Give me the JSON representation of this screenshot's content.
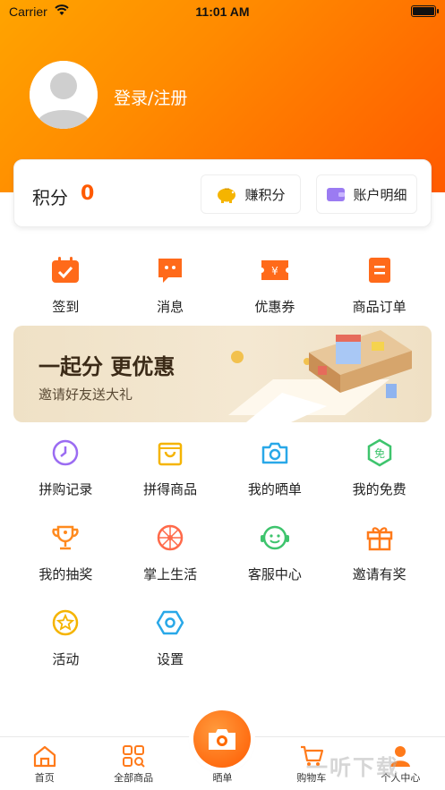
{
  "status_bar": {
    "carrier": "Carrier",
    "time": "11:01 AM"
  },
  "profile": {
    "login_label": "登录/注册"
  },
  "points": {
    "label": "积分",
    "value": "0",
    "earn_label": "赚积分",
    "detail_label": "账户明细"
  },
  "quick_actions": [
    {
      "label": "签到",
      "icon": "checkin-icon"
    },
    {
      "label": "消息",
      "icon": "message-icon"
    },
    {
      "label": "优惠券",
      "icon": "coupon-icon"
    },
    {
      "label": "商品订单",
      "icon": "order-icon"
    }
  ],
  "banner": {
    "title": "一起分 更优惠",
    "subtitle": "邀请好友送大礼"
  },
  "services": [
    {
      "label": "拼购记录",
      "icon": "clock-icon",
      "color": "#9b6cf2"
    },
    {
      "label": "拼得商品",
      "icon": "bag-icon",
      "color": "#f5b400"
    },
    {
      "label": "我的晒单",
      "icon": "camera-icon",
      "color": "#29a8e8"
    },
    {
      "label": "我的免费",
      "icon": "free-icon",
      "color": "#3ec46d"
    },
    {
      "label": "我的抽奖",
      "icon": "trophy-icon",
      "color": "#ff8a1e"
    },
    {
      "label": "掌上生活",
      "icon": "wheel-icon",
      "color": "#ff6a4a"
    },
    {
      "label": "客服中心",
      "icon": "service-icon",
      "color": "#3ec46d"
    },
    {
      "label": "邀请有奖",
      "icon": "gift-icon",
      "color": "#ff7a1a"
    },
    {
      "label": "活动",
      "icon": "star-icon",
      "color": "#f5b400"
    },
    {
      "label": "设置",
      "icon": "settings-icon",
      "color": "#29a8e8"
    }
  ],
  "tabbar": [
    {
      "label": "首页",
      "icon": "home-icon"
    },
    {
      "label": "全部商品",
      "icon": "grid-icon"
    },
    {
      "label": "晒单",
      "icon": "camera-icon"
    },
    {
      "label": "购物车",
      "icon": "cart-icon"
    },
    {
      "label": "个人中心",
      "icon": "user-icon"
    }
  ],
  "watermark": "一听下载",
  "colors": {
    "accent": "#ff6a00",
    "points": "#ff5a00"
  }
}
